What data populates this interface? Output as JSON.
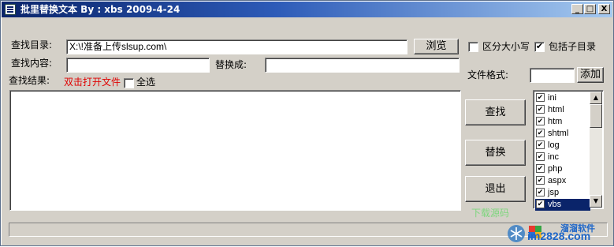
{
  "window": {
    "title": "批里替换文本  By : xbs 2009-4-24",
    "controls": {
      "minimize": "_",
      "maximize": "□",
      "close": "X"
    }
  },
  "search_dir": {
    "label": "查找目录:",
    "value": "X:\\!准备上传slsup.com\\",
    "browse_label": "浏览"
  },
  "options": {
    "case_sensitive_label": "区分大小写",
    "case_sensitive_checked": false,
    "include_subdirs_label": "包括子目录",
    "include_subdirs_checked": true
  },
  "find": {
    "label": "查找内容:",
    "value": ""
  },
  "replace": {
    "label": "替换成:",
    "value": ""
  },
  "file_format": {
    "label": "文件格式:",
    "value": "",
    "add_label": "添加"
  },
  "results": {
    "label": "查找结果:",
    "hint": "双击打开文件",
    "select_all_label": "全选",
    "select_all_checked": false
  },
  "actions": {
    "search": "查找",
    "replace": "替换",
    "exit": "退出"
  },
  "download_link": "下载源码",
  "file_types": [
    {
      "label": "ini",
      "checked": true,
      "selected": false
    },
    {
      "label": "html",
      "checked": true,
      "selected": false
    },
    {
      "label": "htm",
      "checked": true,
      "selected": false
    },
    {
      "label": "shtml",
      "checked": true,
      "selected": false
    },
    {
      "label": "log",
      "checked": true,
      "selected": false
    },
    {
      "label": "inc",
      "checked": true,
      "selected": false
    },
    {
      "label": "php",
      "checked": true,
      "selected": false
    },
    {
      "label": "aspx",
      "checked": true,
      "selected": false
    },
    {
      "label": "jsp",
      "checked": true,
      "selected": false
    },
    {
      "label": "vbs",
      "checked": true,
      "selected": true
    }
  ],
  "watermark": {
    "brand_cn": "溜溜软件",
    "brand_url": "im2828.com"
  }
}
